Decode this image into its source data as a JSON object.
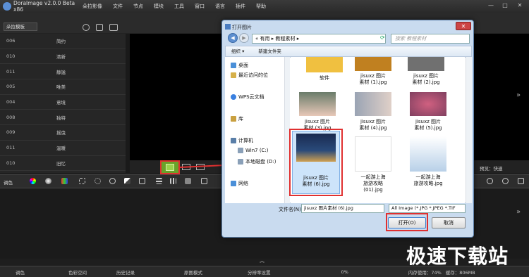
{
  "app": {
    "title": "DoraImage v2.0.0 Beta x86",
    "menu": [
      "朵拉影像",
      "文件",
      "节点",
      "模块",
      "工具",
      "窗口",
      "语言",
      "插件",
      "帮助"
    ],
    "window_controls": [
      "—",
      "□",
      "✕"
    ],
    "template_select": "朵拉模板"
  },
  "presets": [
    {
      "code": "006",
      "label": "简约"
    },
    {
      "code": "010",
      "label": "清新"
    },
    {
      "code": "011",
      "label": "静謐"
    },
    {
      "code": "005",
      "label": "唯美"
    },
    {
      "code": "004",
      "label": "意境"
    },
    {
      "code": "008",
      "label": "独特"
    },
    {
      "code": "009",
      "label": "摇曳"
    },
    {
      "code": "011",
      "label": "温暖"
    },
    {
      "code": "010",
      "label": "旧忆"
    }
  ],
  "preview_mode": "预览：快速",
  "fx_label": "调色",
  "status": {
    "items": [
      "调色",
      "色彩空间",
      "历史记录",
      "原图模式",
      "分辨率设置"
    ],
    "progress": "0%",
    "memory": "内存使用：74%",
    "cache": "缓存：806MB"
  },
  "colors": {
    "accent_red": "#e03030",
    "open_green": "#6aa12a"
  },
  "dialog": {
    "title": "打开图片",
    "close": "✕",
    "address": "« 有用 ▸ 教程素材 ▸",
    "search_placeholder": "搜索 教程素材",
    "organize": "组织 ▾",
    "new_folder": "新建文件夹",
    "nav": [
      "桌面",
      "最近访问的位",
      "WPS云文档",
      "库",
      "计算机",
      "Win7 (C:)",
      "本地磁盘 (D:)",
      "网络"
    ],
    "files": [
      "软件",
      "jisuxz 图片\n素材 (1).jpg",
      "jisuxz 图片\n素材 (2).jpg",
      "jisuxz 图片\n素材 (3).jpg",
      "jisuxz 图片\n素材 (4).jpg",
      "jisuxz 图片\n素材 (5).jpg",
      "jisuxz 图片\n素材 (6).jpg",
      "一起游上海\n旅游攻略\n(01).jpg",
      "一起游上海\n旅游攻略.jpg"
    ],
    "filename_label": "文件名(N):",
    "filename": "jisuxz 图片素材 (6).jpg",
    "filetype": "All Image (*.JPG *.JPEG *.TIF",
    "open": "打开(O)",
    "cancel": "取消"
  },
  "watermark": "极速下载站"
}
